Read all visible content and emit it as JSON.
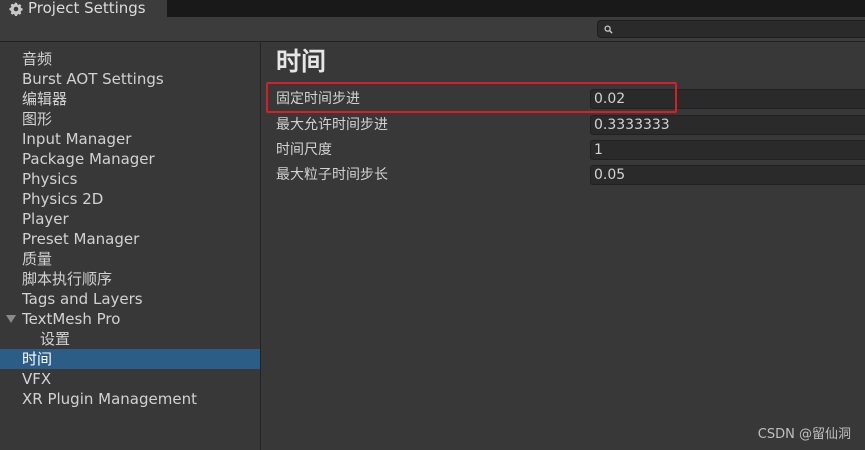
{
  "window": {
    "tab_title": "Project Settings",
    "tab_icon": "gear-icon"
  },
  "search": {
    "placeholder": "",
    "icon": "search-icon"
  },
  "sidebar": {
    "items": [
      {
        "label": "音频"
      },
      {
        "label": "Burst AOT Settings"
      },
      {
        "label": "编辑器"
      },
      {
        "label": "图形"
      },
      {
        "label": "Input Manager"
      },
      {
        "label": "Package Manager"
      },
      {
        "label": "Physics"
      },
      {
        "label": "Physics 2D"
      },
      {
        "label": "Player"
      },
      {
        "label": "Preset Manager"
      },
      {
        "label": "质量"
      },
      {
        "label": "脚本执行顺序"
      },
      {
        "label": "Tags and Layers"
      },
      {
        "label": "TextMesh Pro",
        "expanded": true
      },
      {
        "label": "设置",
        "child": true
      },
      {
        "label": "时间",
        "selected": true
      },
      {
        "label": "VFX"
      },
      {
        "label": "XR Plugin Management"
      }
    ]
  },
  "content": {
    "title": "时间",
    "fields": [
      {
        "label": "固定时间步进",
        "value": "0.02"
      },
      {
        "label": "最大允许时间步进",
        "value": "0.3333333"
      },
      {
        "label": "时间尺度",
        "value": "1"
      },
      {
        "label": "最大粒子时间步长",
        "value": "0.05"
      }
    ]
  },
  "highlight_color": "#d61f26",
  "selection_color": "#2c5d87",
  "watermark": "CSDN @留仙洞"
}
